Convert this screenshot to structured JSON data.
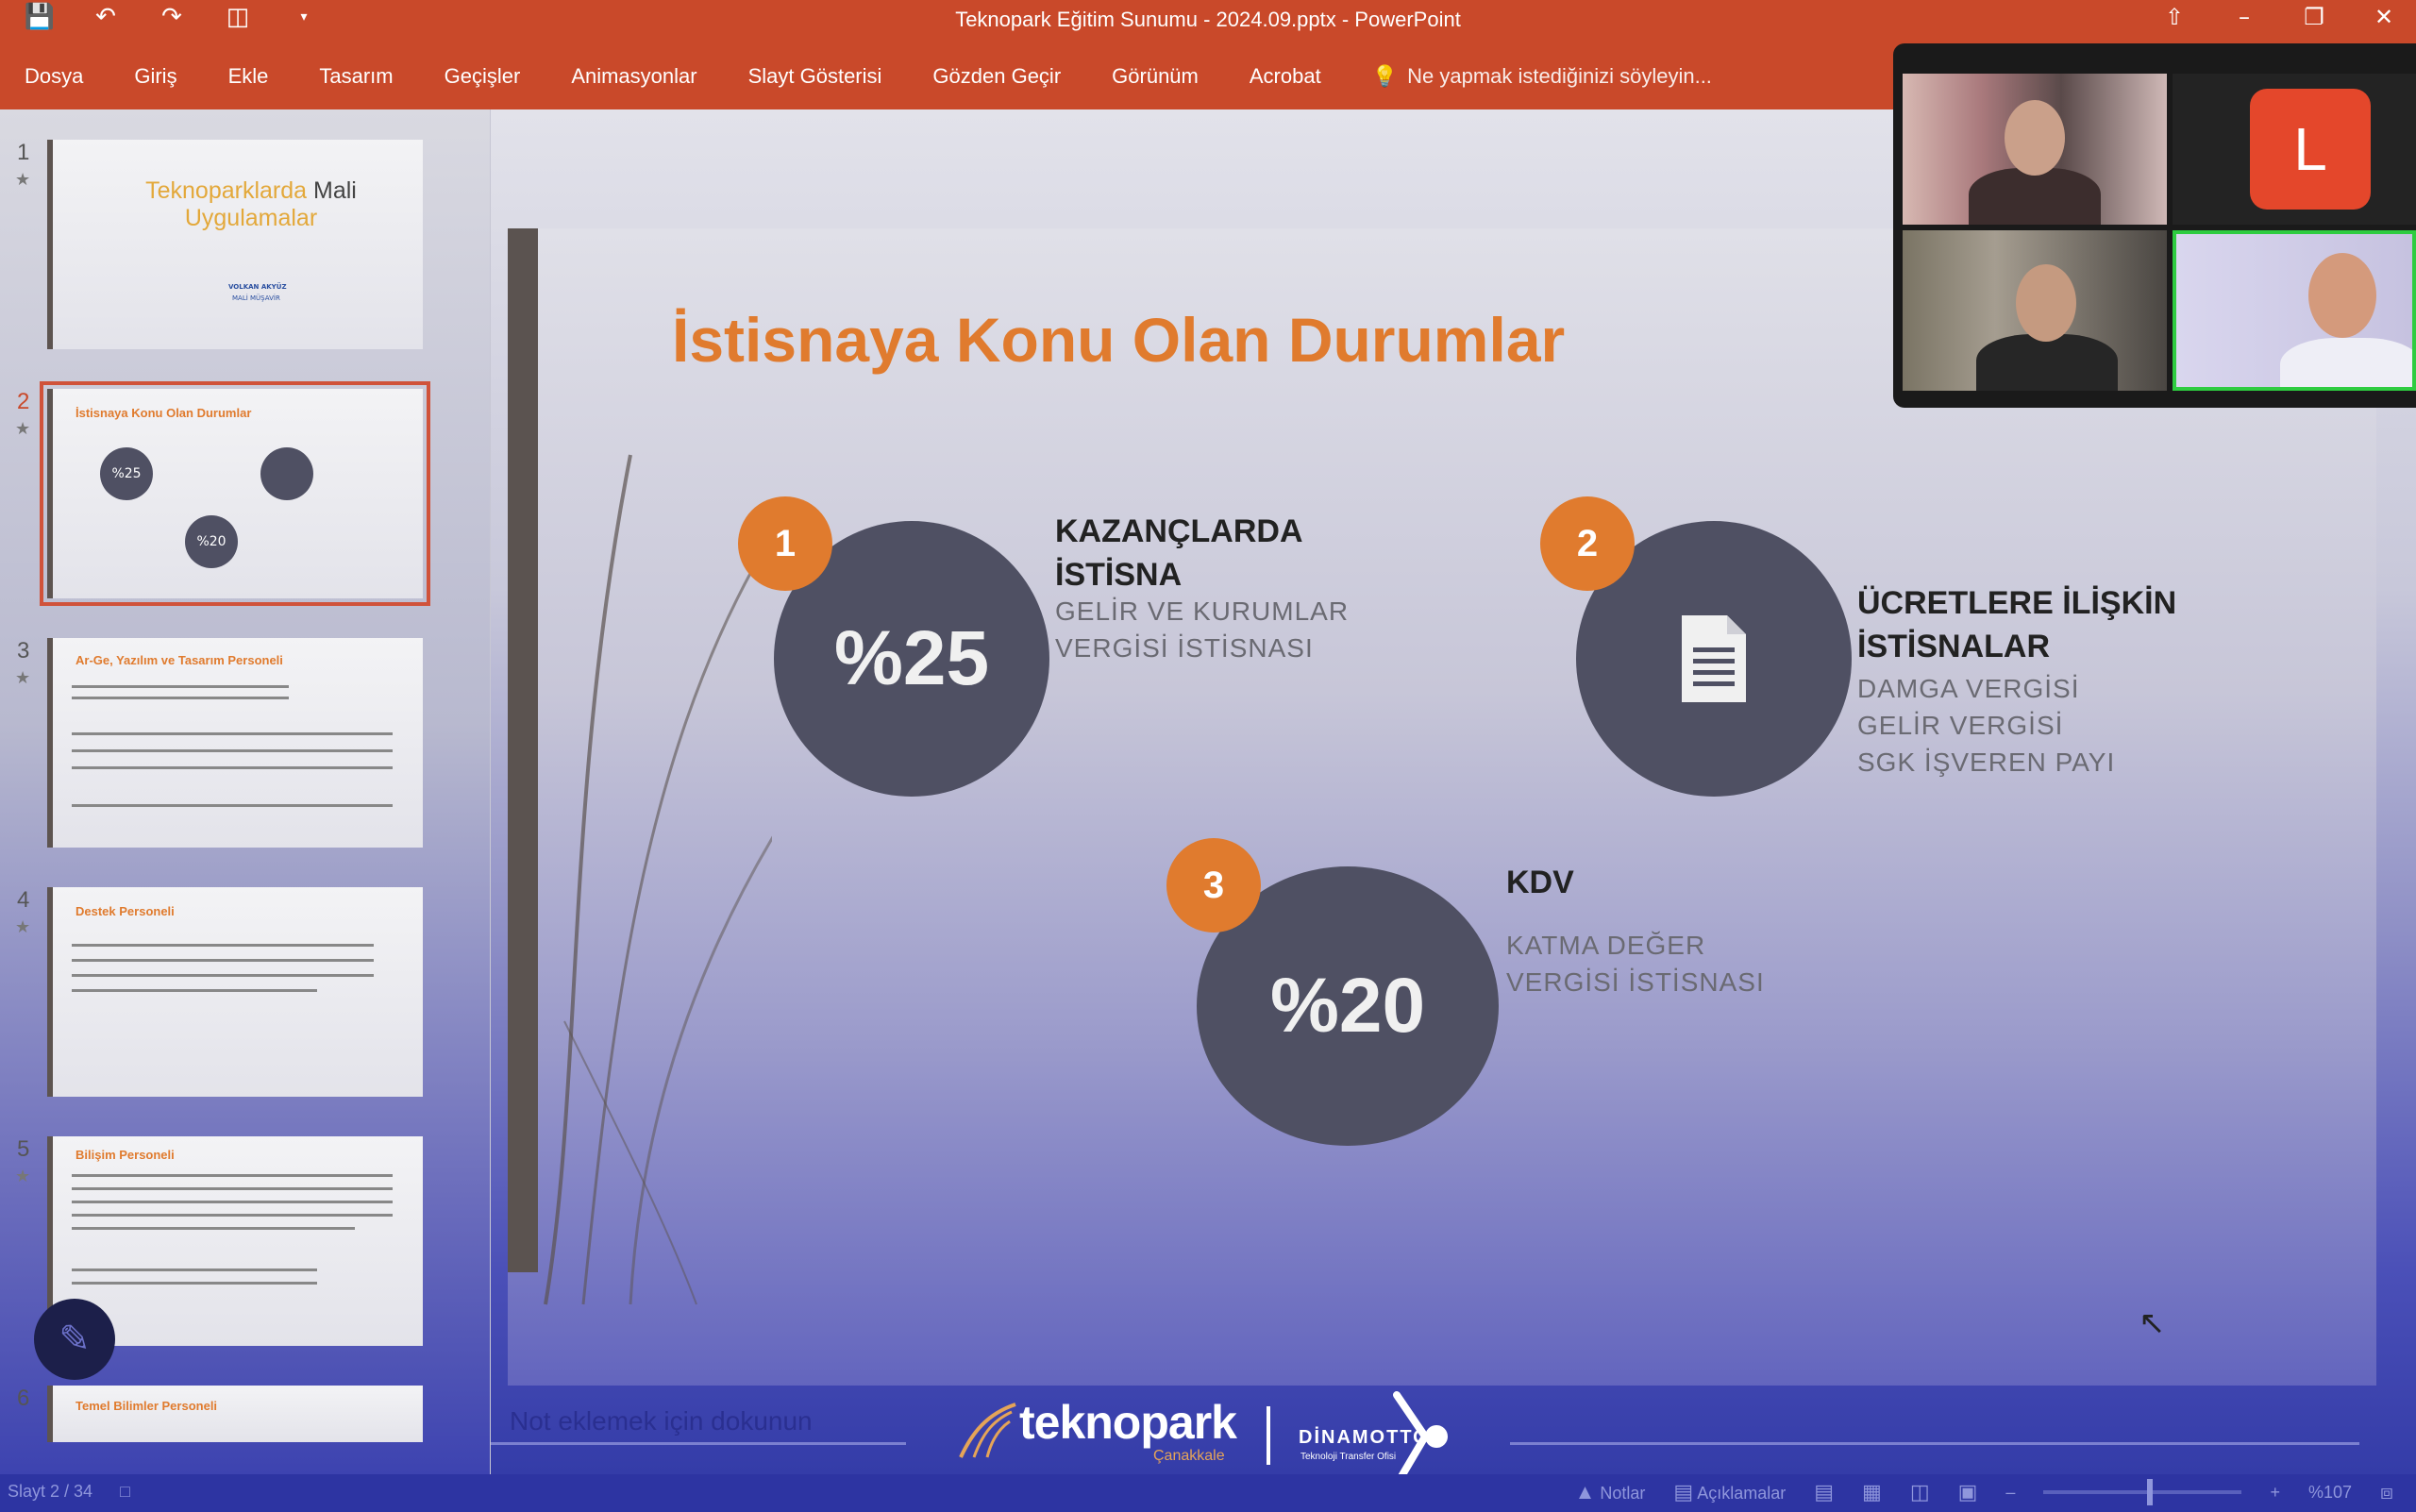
{
  "window": {
    "title": "Teknopark Eğitim Sunumu - 2024.09.pptx - PowerPoint"
  },
  "ribbon": {
    "tabs": [
      "Dosya",
      "Giriş",
      "Ekle",
      "Tasarım",
      "Geçişler",
      "Animasyonlar",
      "Slayt Gösterisi",
      "Gözden Geçir",
      "Görünüm",
      "Acrobat"
    ],
    "tell_me": "Ne yapmak istediğinizi söyleyin..."
  },
  "thumbnails": [
    {
      "num": "1",
      "title_orange": "Teknoparklarda",
      "title_dark": "Mali",
      "title_line2": "Uygulamalar",
      "sub1": "VOLKAN AKYÜZ",
      "sub2": "MALİ MÜŞAVİR"
    },
    {
      "num": "2",
      "title": "İstisnaya Konu Olan Durumlar",
      "p1": "%25",
      "p2": "%20"
    },
    {
      "num": "3",
      "title": "Ar-Ge, Yazılım ve Tasarım Personeli"
    },
    {
      "num": "4",
      "title": "Destek Personeli"
    },
    {
      "num": "5",
      "title": "Bilişim Personeli"
    },
    {
      "num": "6",
      "title": "Temel Bilimler Personeli"
    }
  ],
  "slide": {
    "heading": "İstisnaya Konu Olan Durumlar",
    "items": [
      {
        "badge": "1",
        "circle": "%25",
        "title_line1": "KAZANÇLARDA",
        "title_line2": "İSTİSNA",
        "sub_line1": "GELİR VE KURUMLAR",
        "sub_line2": "VERGİSİ İSTİSNASI"
      },
      {
        "badge": "2",
        "icon": "document-icon",
        "title_line1": "ÜCRETLERE İLİŞKİN",
        "title_line2": "İSTİSNALAR",
        "sub_line1": "DAMGA VERGİSİ",
        "sub_line2": "GELİR VERGİSİ",
        "sub_line3": "SGK İŞVEREN PAYI"
      },
      {
        "badge": "3",
        "circle": "%20",
        "title_line1": "KDV",
        "sub_line1": "KATMA DEĞER",
        "sub_line2": "VERGİSİ İSTİSNASI"
      }
    ]
  },
  "notes_placeholder": "Not eklemek için dokunun",
  "logos": {
    "teknopark": "teknopark",
    "teknopark_sub": "Çanakkale",
    "dinamotto": "DİNAMOTTO",
    "dinamotto_sub": "Teknoloji Transfer Ofisi"
  },
  "status": {
    "slide_counter": "Slayt 2 / 34",
    "notes": "Notlar",
    "comments": "Açıklamalar",
    "zoom": "%107"
  },
  "video": {
    "avatar_initial": "L"
  },
  "colors": {
    "accent_orange": "#e07b2e",
    "ribbon_red": "#c9492a",
    "circle_gray": "#4f5063",
    "avatar_red": "#e4472b",
    "active_speaker_green": "#2ecc40"
  }
}
